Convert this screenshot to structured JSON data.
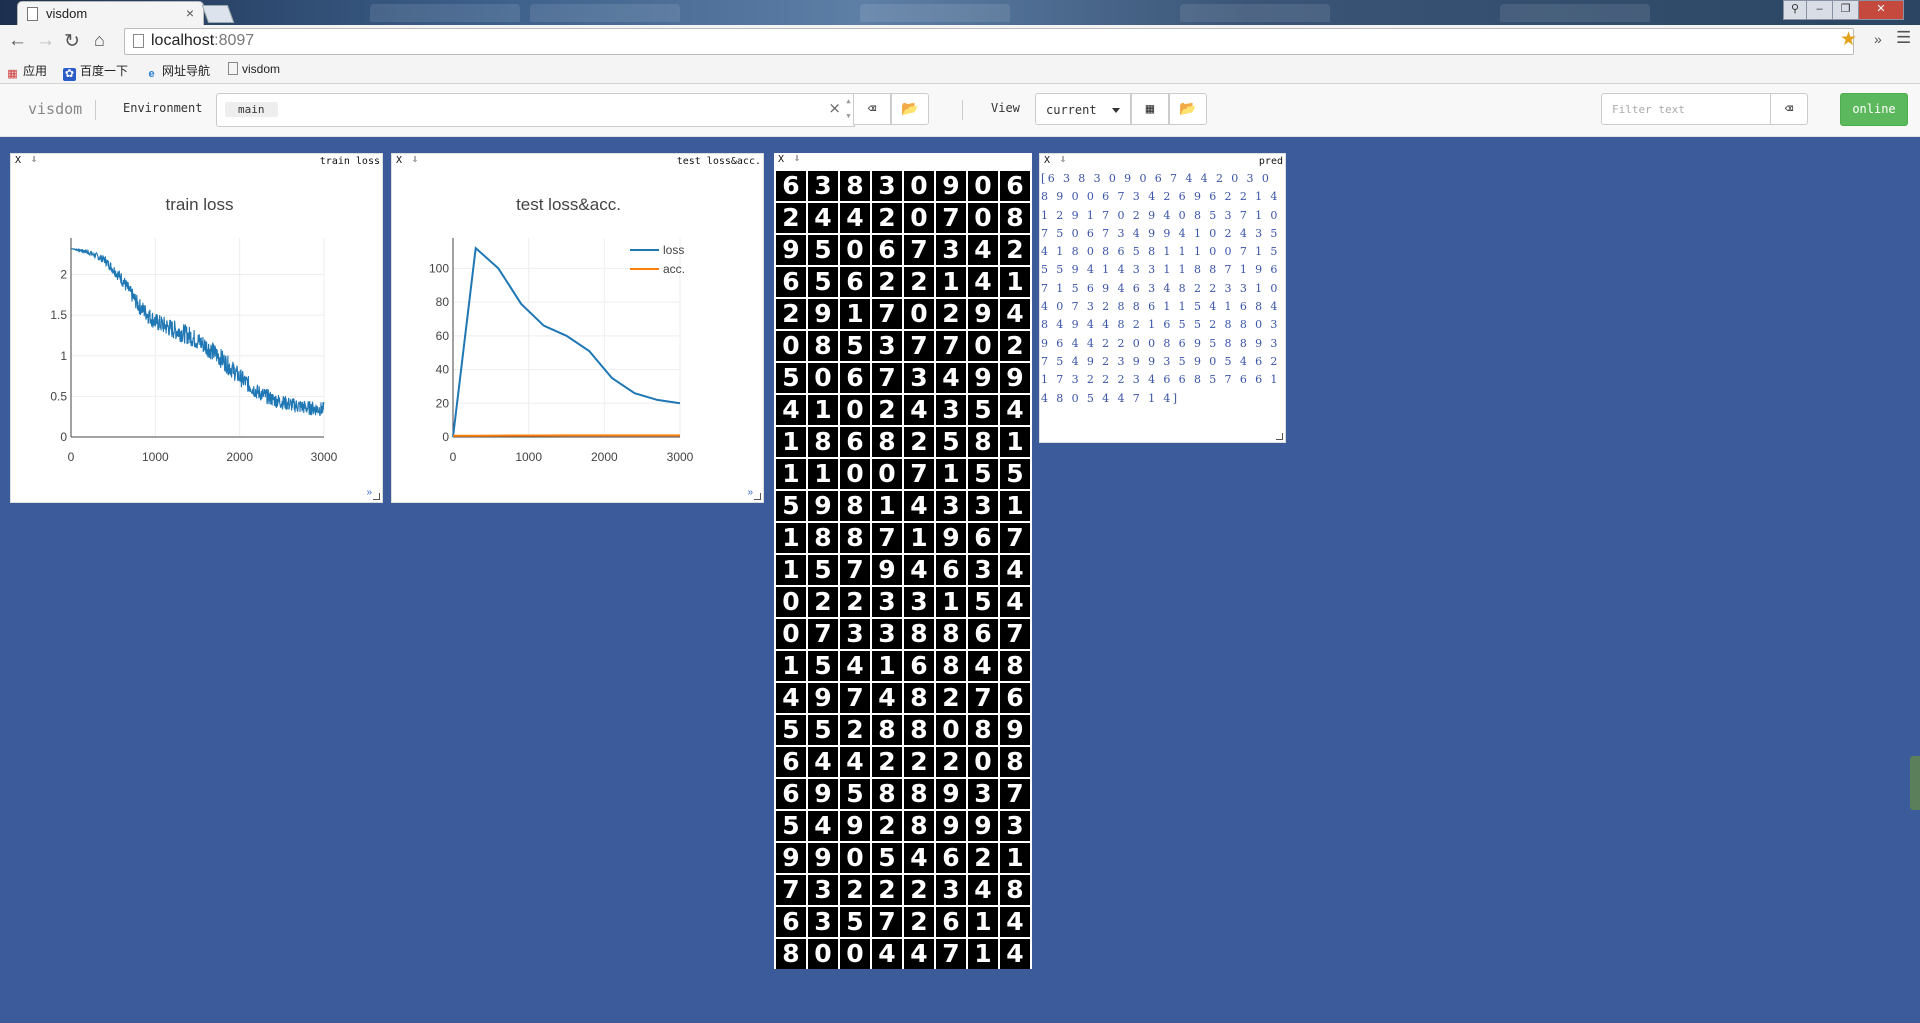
{
  "browser": {
    "tab_title": "visdom",
    "tab_close": "×",
    "url_host": "localhost",
    "url_port": ":8097",
    "bookmarks": [
      "应用",
      "百度一下",
      "网址导航",
      "visdom"
    ]
  },
  "navbar": {
    "brand": "visdom",
    "env_label": "Environment",
    "env_selected": "main",
    "env_clear": "×",
    "view_label": "View",
    "view_selected": "current",
    "filter_placeholder": "Filter text",
    "status_button": "online"
  },
  "panes": {
    "close_glyph": "X",
    "download_glyph": "⇩",
    "train": {
      "title": "train loss",
      "expand": "»"
    },
    "test": {
      "title": "test loss&acc.",
      "expand": "»"
    },
    "images": {
      "title": ""
    },
    "pred": {
      "title": "pred",
      "text": "[6 3 8 3 0 9 0 6 7 4 4 2 0 3 0 8 9 0 0 6 7 3 4 2 6 9 6 2 2 1 4 1 2 9 1 7 0 2 9 4 0 8 5 3 7 1 0 7 5 0 6 7 3 4 9 9 4 1 0 2 4 3 5 4 1 8 0 8 6 5 8 1 1 1 0 0 7 1 5 5 5 9 4 1 4 3 3 1 1 8 8 7 1 9 6 7 1 5 6 9 4 6 3 4 8 2 2 3 3 1 0 4 0 7 3 2 8 8 6 1 1 5 4 1 6 8 4 8 4 9 4 4 8 2 1 6 5 5 2 8 8 0 3 9 6 4 4 2 2 0 0 8 6 9 5 8 8 9 3 7 5 4 9 2 3 9 9 3 5 9 0 5 4 6 2 1 7 3 2 2 2 3 4 6 6 8 5 7 6 6 1 4 8 0 5 4 4 7 1 4]"
    }
  },
  "digits": [
    "63830906",
    "24420708",
    "95067342",
    "65622141",
    "29170294",
    "08537702",
    "50673499",
    "41024354",
    "18682581",
    "11007155",
    "59814331",
    "18871967",
    "15794634",
    "02233154",
    "07338867",
    "15416848",
    "49748276",
    "55288089",
    "64422208",
    "69588937",
    "54928993",
    "99054621",
    "73222348",
    "63572614",
    "80044714"
  ],
  "chart_data": [
    {
      "type": "line",
      "title": "train loss",
      "x_ticks": [
        "0",
        "1000",
        "2000",
        "3000"
      ],
      "y_ticks": [
        "0",
        "0.5",
        "1",
        "1.5",
        "2"
      ],
      "xlim": [
        0,
        3000
      ],
      "ylim": [
        0,
        2.45
      ],
      "grid": true,
      "legend": "none",
      "series": [
        {
          "x": [
            0,
            200,
            400,
            600,
            800,
            1000,
            1200,
            1400,
            1600,
            1800,
            2000,
            2200,
            2400,
            2600,
            2800,
            3000
          ],
          "y": [
            2.32,
            2.28,
            2.18,
            1.95,
            1.62,
            1.42,
            1.33,
            1.25,
            1.12,
            0.95,
            0.74,
            0.56,
            0.46,
            0.4,
            0.36,
            0.34
          ],
          "noise": [
            0,
            0.03,
            0.05,
            0.08,
            0.1,
            0.11,
            0.12,
            0.12,
            0.12,
            0.12,
            0.11,
            0.1,
            0.09,
            0.09,
            0.09,
            0.09
          ],
          "color": "#1f77b4"
        }
      ]
    },
    {
      "type": "line",
      "title": "test loss&acc.",
      "x_ticks": [
        "0",
        "1000",
        "2000",
        "3000"
      ],
      "y_ticks": [
        "0",
        "20",
        "40",
        "60",
        "80",
        "100"
      ],
      "xlim": [
        0,
        3000
      ],
      "ylim": [
        0,
        118
      ],
      "grid": true,
      "legend": "top-right",
      "series": [
        {
          "name": "loss",
          "color": "#1f77b4",
          "x": [
            0,
            300,
            600,
            900,
            1200,
            1500,
            1800,
            2100,
            2400,
            2700,
            3000
          ],
          "y": [
            0,
            112,
            100,
            79,
            66,
            60,
            51,
            35,
            26,
            22,
            20
          ]
        },
        {
          "name": "acc.",
          "color": "#ff7f0e",
          "x": [
            0,
            300,
            600,
            900,
            1200,
            1500,
            1800,
            2100,
            2400,
            2700,
            3000
          ],
          "y": [
            0.7,
            0.8,
            0.85,
            0.88,
            0.9,
            0.92,
            0.93,
            0.95,
            0.96,
            0.97,
            0.97
          ]
        }
      ]
    }
  ],
  "colors": {
    "background": "#3c5b9b",
    "accent": "#5cb85c",
    "series_blue": "#1f77b4",
    "series_orange": "#ff7f0e"
  }
}
